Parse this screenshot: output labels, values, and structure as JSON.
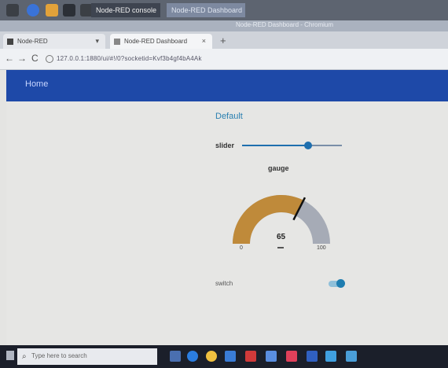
{
  "os_top": {
    "tasks": [
      {
        "label": "Node-RED console"
      },
      {
        "label": "Node-RED Dashboard"
      }
    ]
  },
  "window": {
    "title": "Node-RED Dashboard - Chromium"
  },
  "browser": {
    "tabs": [
      {
        "label": "Node-RED",
        "active": false
      },
      {
        "label": "Node-RED Dashboard",
        "active": true
      }
    ],
    "url": "127.0.0.1:1880/ui/#!/0?socketid=Kvf3b4gf4bA4Ak"
  },
  "dashboard": {
    "header_title": "Home",
    "group_title": "Default",
    "slider": {
      "label": "slider",
      "value_fraction": 0.66
    },
    "gauge": {
      "title": "gauge",
      "value": "65",
      "min": "0",
      "max": "100",
      "value_number": 65
    },
    "switch": {
      "label": "switch",
      "on": true
    }
  },
  "taskbar": {
    "search_placeholder": "Type here to search"
  },
  "colors": {
    "header": "#1e49a8",
    "accent": "#1e6fae",
    "gauge_fill": "#bf8a3a",
    "gauge_track": "#a6abb6"
  }
}
